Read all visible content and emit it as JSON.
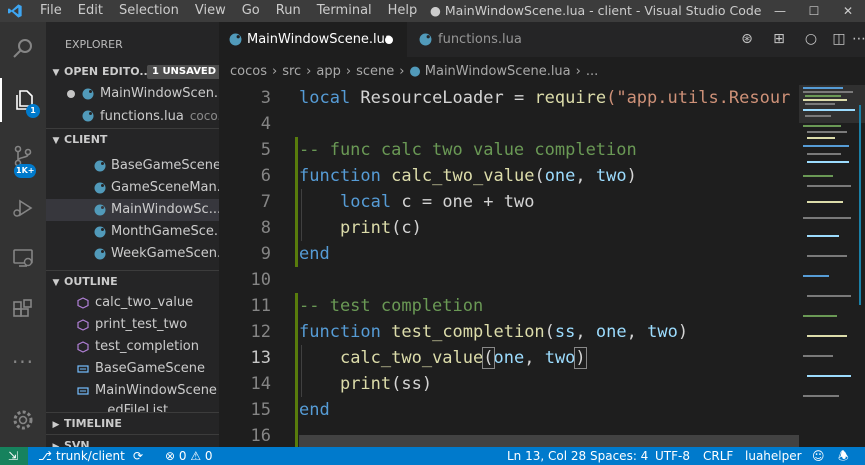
{
  "titlebar": {
    "menus": [
      "File",
      "Edit",
      "Selection",
      "View",
      "Go",
      "Run",
      "Terminal",
      "Help"
    ],
    "window_title": "● MainWindowScene.lua - client - Visual Studio Code"
  },
  "activity": {
    "explorer_badge": "1",
    "scm_badge": "1K+"
  },
  "sidebar": {
    "title": "EXPLORER",
    "open_editors": {
      "header": "OPEN EDITO...",
      "unsaved_badge": "1 UNSAVED",
      "items": [
        {
          "label": "MainWindowScen...",
          "dirty": true
        },
        {
          "label": "functions.lua",
          "hint": "coco..."
        }
      ]
    },
    "client": {
      "header": "CLIENT",
      "items": [
        "BaseGameScene....",
        "GameSceneMan...",
        "MainWindowSc...",
        "MonthGameSce...",
        "WeekGameScen..."
      ]
    },
    "outline": {
      "header": "OUTLINE",
      "items": [
        "calc_two_value",
        "print_test_two",
        "test_completion",
        "BaseGameScene",
        "MainWindowScene",
        "...edFileList"
      ]
    },
    "timeline_header": "TIMELINE",
    "svn_header": "SVN"
  },
  "tabs": [
    {
      "label": "MainWindowScene.lua",
      "active": true,
      "dirty": true
    },
    {
      "label": "functions.lua",
      "active": false
    }
  ],
  "breadcrumb": [
    "cocos",
    "src",
    "app",
    "scene",
    "MainWindowScene.lua",
    "..."
  ],
  "editor": {
    "lines": [
      {
        "n": "3"
      },
      {
        "n": "4"
      },
      {
        "n": "5"
      },
      {
        "n": "6"
      },
      {
        "n": "7"
      },
      {
        "n": "8"
      },
      {
        "n": "9"
      },
      {
        "n": "10"
      },
      {
        "n": "11"
      },
      {
        "n": "12"
      },
      {
        "n": "13"
      },
      {
        "n": "14"
      },
      {
        "n": "15"
      },
      {
        "n": "16"
      }
    ],
    "code": {
      "l3_kw": "local",
      "l3_var": " ResourceLoader ",
      "l3_op": "= ",
      "l3_fn": "require",
      "l3_str": "(\"app.utils.Resour",
      "l5": "-- func calc two value completion",
      "l6_kw": "function",
      "l6_fn": "calc_two_value",
      "l6_p1": "(",
      "l6_a": "one",
      "l6_c": ", ",
      "l6_b": "two",
      "l6_p2": ")",
      "l7_kw": "local",
      "l7_rest": " c = one + two",
      "l8_fn": "print",
      "l8_rest": "(c)",
      "l9": "end",
      "l11": "-- test completion",
      "l12_kw": "function",
      "l12_fn": "test_completion",
      "l12_p1": "(",
      "l12_a": "ss",
      "l12_c1": ", ",
      "l12_b": "one",
      "l12_c2": ", ",
      "l12_d": "two",
      "l12_p2": ")",
      "l13_fn": "calc_two_value",
      "l13_p1": "(",
      "l13_a": "one",
      "l13_c": ", ",
      "l13_b": "two",
      "l13_p2": ")",
      "l14_fn": "print",
      "l14_rest": "(ss)",
      "l15": "end"
    }
  },
  "status": {
    "branch": "trunk/client",
    "sync": "⟳",
    "problems": "⊗ 0 ⚠ 0",
    "position": "Ln 13, Col 28",
    "spaces": "Spaces: 4",
    "encoding": "UTF-8",
    "eol": "CRLF",
    "language": "luahelper"
  },
  "colors": {
    "accent": "#007acc",
    "keyword": "#569cd6",
    "function": "#dcdcaa",
    "comment": "#6a9955",
    "string": "#ce9178",
    "variable": "#9cdcfe"
  }
}
